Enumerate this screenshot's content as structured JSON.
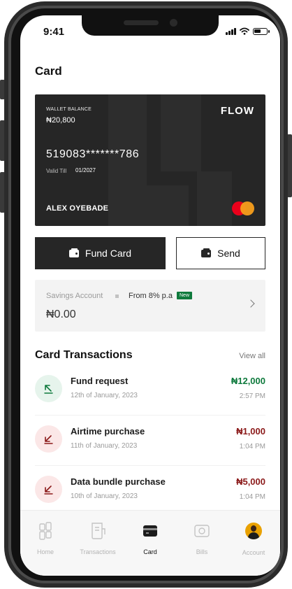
{
  "status_bar": {
    "time": "9:41"
  },
  "page": {
    "title": "Card"
  },
  "card": {
    "wallet_label": "WALLET BALANCE",
    "wallet_balance": "₦20,800",
    "brand": "FLOW",
    "number": "519083*******786",
    "valid_label": "Valid Till",
    "valid_value": "01/2027",
    "holder": "ALEX OYEBADE",
    "network_icon": "mastercard-logo"
  },
  "actions": {
    "fund_label": "Fund Card",
    "send_label": "Send"
  },
  "savings": {
    "name": "Savings Account",
    "rate": "From 8% p.a",
    "badge": "New",
    "amount": "₦0.00"
  },
  "transactions": {
    "title": "Card Transactions",
    "view_all": "View all",
    "items": [
      {
        "name": "Fund request",
        "date": "12th of January, 2023",
        "amount": "₦12,000",
        "time": "2:57 PM",
        "direction": "in"
      },
      {
        "name": "Airtime purchase",
        "date": "11th of January, 2023",
        "amount": "₦1,000",
        "time": "1:04 PM",
        "direction": "out"
      },
      {
        "name": "Data bundle purchase",
        "date": "10th of January, 2023",
        "amount": "₦5,000",
        "time": "1:04 PM",
        "direction": "out"
      }
    ]
  },
  "nav": {
    "items": [
      {
        "label": "Home",
        "icon": "home-icon"
      },
      {
        "label": "Transactions",
        "icon": "receipt-icon"
      },
      {
        "label": "Card",
        "icon": "card-icon",
        "active": true
      },
      {
        "label": "Bills",
        "icon": "bills-icon"
      },
      {
        "label": "Account",
        "icon": "avatar"
      }
    ]
  },
  "colors": {
    "dark": "#262626",
    "credit": "#0f7a3d",
    "debit": "#8b1a1a",
    "badge": "#0f7a3d"
  }
}
